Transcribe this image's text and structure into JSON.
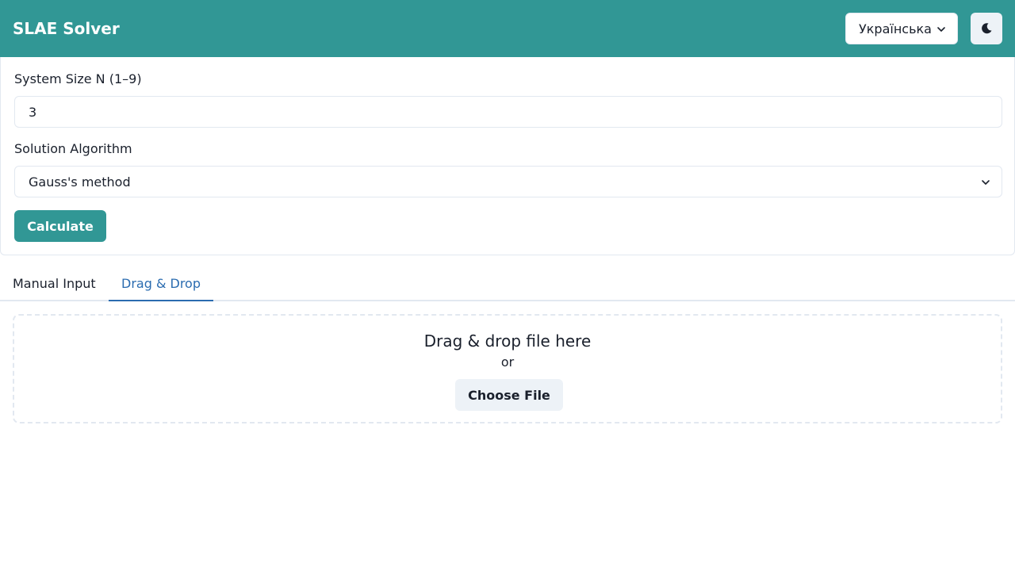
{
  "header": {
    "title": "SLAE Solver",
    "language": "Українська",
    "theme_icon": "moon-icon",
    "color": "#319795"
  },
  "settings": {
    "size_label": "System Size N (1–9)",
    "size_value": "3",
    "algorithm_label": "Solution Algorithm",
    "algorithm_value": "Gauss's method",
    "calculate_label": "Calculate"
  },
  "tabs": [
    {
      "label": "Manual Input",
      "active": false
    },
    {
      "label": "Drag & Drop",
      "active": true
    }
  ],
  "dropzone": {
    "title": "Drag & drop file here",
    "or": "or",
    "choose_label": "Choose File"
  },
  "colors": {
    "accent": "#319795",
    "tab_active": "#2b6cb0",
    "border": "#e2e8f0"
  }
}
